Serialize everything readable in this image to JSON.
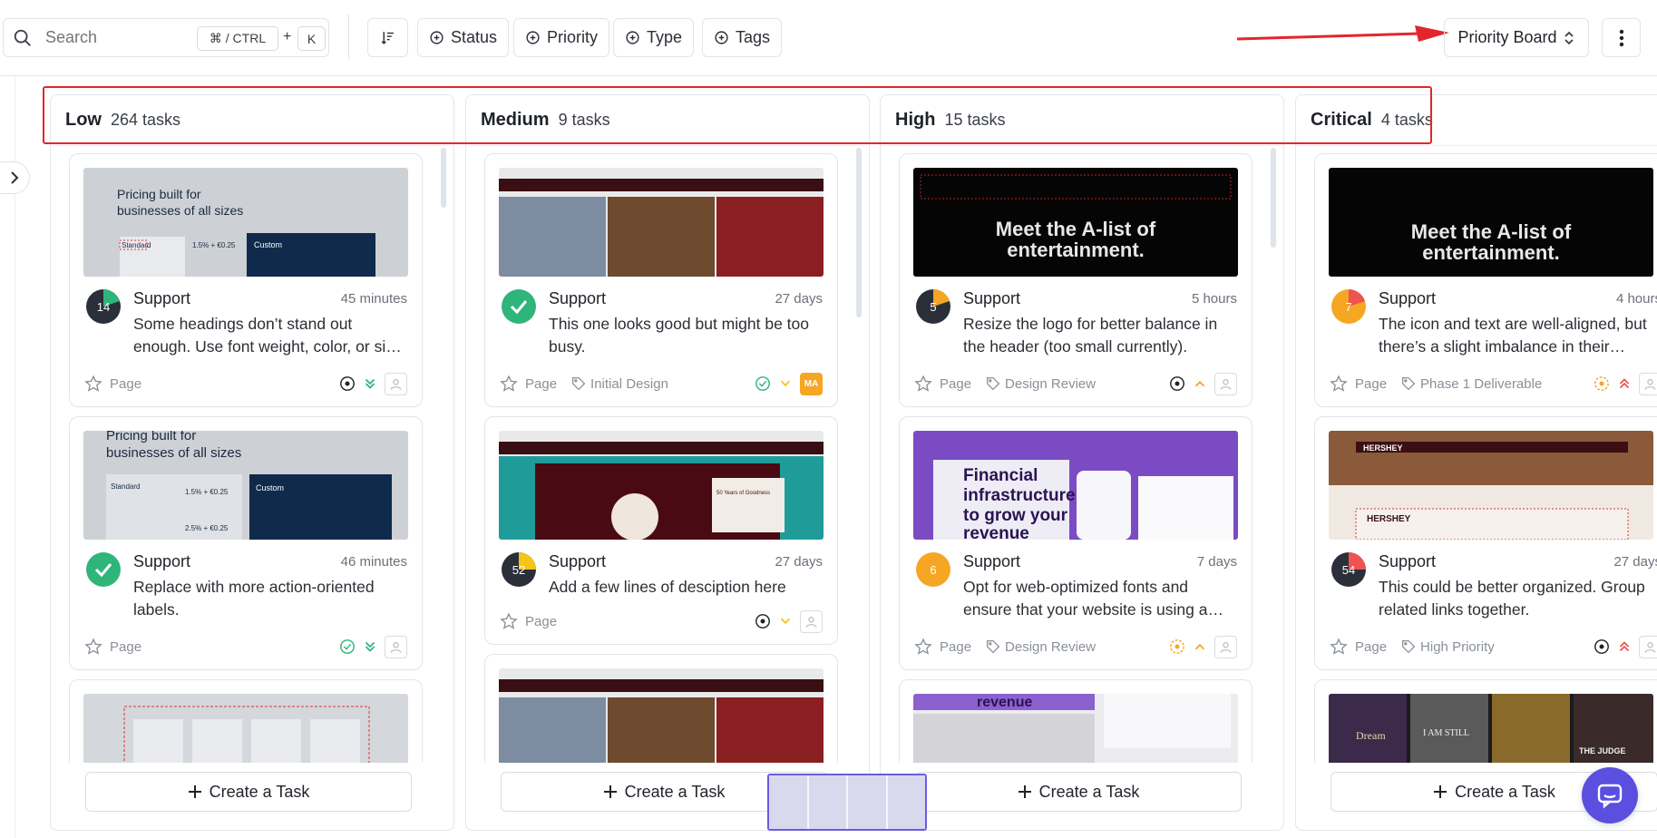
{
  "toolbar": {
    "search_placeholder": "Search",
    "shortcut_main": "⌘ / CTRL",
    "shortcut_plus": "+",
    "shortcut_key": "K",
    "filters": [
      "Status",
      "Priority",
      "Type",
      "Tags"
    ],
    "board_view": "Priority Board"
  },
  "columns": [
    {
      "title": "Low",
      "count": "264 tasks"
    },
    {
      "title": "Medium",
      "count": "9 tasks"
    },
    {
      "title": "High",
      "count": "15 tasks"
    },
    {
      "title": "Critical",
      "count": "4 tasks"
    }
  ],
  "create_label": "Create a Task",
  "cards": {
    "low": [
      {
        "number": "14",
        "category": "Support",
        "time": "45 minutes",
        "desc": "Some headings don’t stand out enough. Use font weight, color, or size to emphasize them.",
        "type": "Page",
        "tag": ""
      },
      {
        "number": "",
        "category": "Support",
        "time": "46 minutes",
        "desc": "Replace with more action-oriented labels.",
        "type": "Page",
        "tag": ""
      }
    ],
    "medium": [
      {
        "number": "",
        "category": "Support",
        "time": "27 days",
        "desc": "This one looks good but might be too busy.",
        "type": "Page",
        "tag": "Initial Design",
        "initials": "MA"
      },
      {
        "number": "52",
        "category": "Support",
        "time": "27 days",
        "desc": "Add a few lines of desciption here",
        "type": "Page",
        "tag": ""
      }
    ],
    "high": [
      {
        "number": "5",
        "category": "Support",
        "time": "5 hours",
        "desc": "Resize the logo for better balance in the header (too small currently).",
        "type": "Page",
        "tag": "Design Review"
      },
      {
        "number": "6",
        "category": "Support",
        "time": "7 days",
        "desc": "Opt for web-optimized fonts and ensure that your website is using a consistent type scale.",
        "type": "Page",
        "tag": "Design Review"
      }
    ],
    "critical": [
      {
        "number": "7",
        "category": "Support",
        "time": "4 hours",
        "desc": "The icon and text are well-aligned, but there’s a slight imbalance in their spacing.",
        "type": "Page",
        "tag": "Phase 1 Deliverable"
      },
      {
        "number": "54",
        "category": "Support",
        "time": "27 days",
        "desc": "This could be better organized. Group related links together.",
        "type": "Page",
        "tag": "High Priority"
      }
    ]
  },
  "thumbnails": {
    "pricing_title": "Pricing built for businesses of all sizes",
    "pricing_standard": "Standard",
    "pricing_custom": "Custom",
    "pricing_fee": "1.5% + €0.25",
    "pricing_fee2": "2.5% + €0.25",
    "hershey_brand": "HERSHEY",
    "hershey_goodness": "50 Years of Goodness",
    "alist_title_1": "Meet the A-list of",
    "alist_title_2": "entertainment.",
    "fin_title_1": "Financial",
    "fin_title_2": "infrastructure",
    "fin_title_3": "to grow your",
    "fin_title_4": "revenue",
    "fin_partial": "revenue",
    "poster_1": "Dream",
    "poster_2": "I AM STILL",
    "poster_3": "THE JUDGE"
  },
  "colors": {
    "accent": "#5b4fe0",
    "annotation_red": "#e3262b",
    "progress_green": "#2fb57a",
    "progress_yellow": "#f5c518",
    "progress_orange": "#f5a623",
    "progress_red": "#ef5350",
    "dark_badge": "#2b2f3a"
  }
}
